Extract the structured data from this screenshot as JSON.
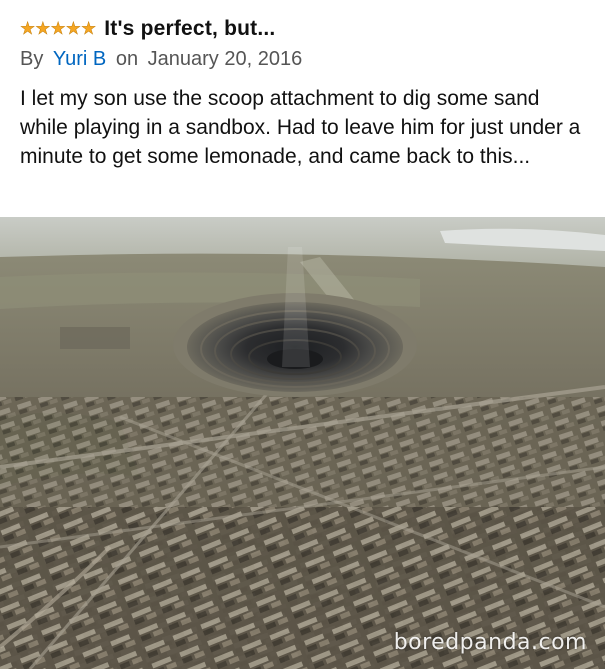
{
  "review": {
    "rating": 5,
    "star_glyph": "★",
    "star_color": "#f5a623",
    "title": "It's perfect, but...",
    "by_label": "By",
    "author": "Yuri B",
    "on_label": "on",
    "date": "January 20, 2016",
    "body": "I let my son use the scoop attachment to dig some sand while playing in a sandbox. Had to leave him for just under a minute to get some lemonade, and came back to this...",
    "author_color": "#0066c0"
  },
  "photo": {
    "subject": "aerial-view-open-pit-mine-and-city",
    "watermark": "boredpanda.com"
  }
}
